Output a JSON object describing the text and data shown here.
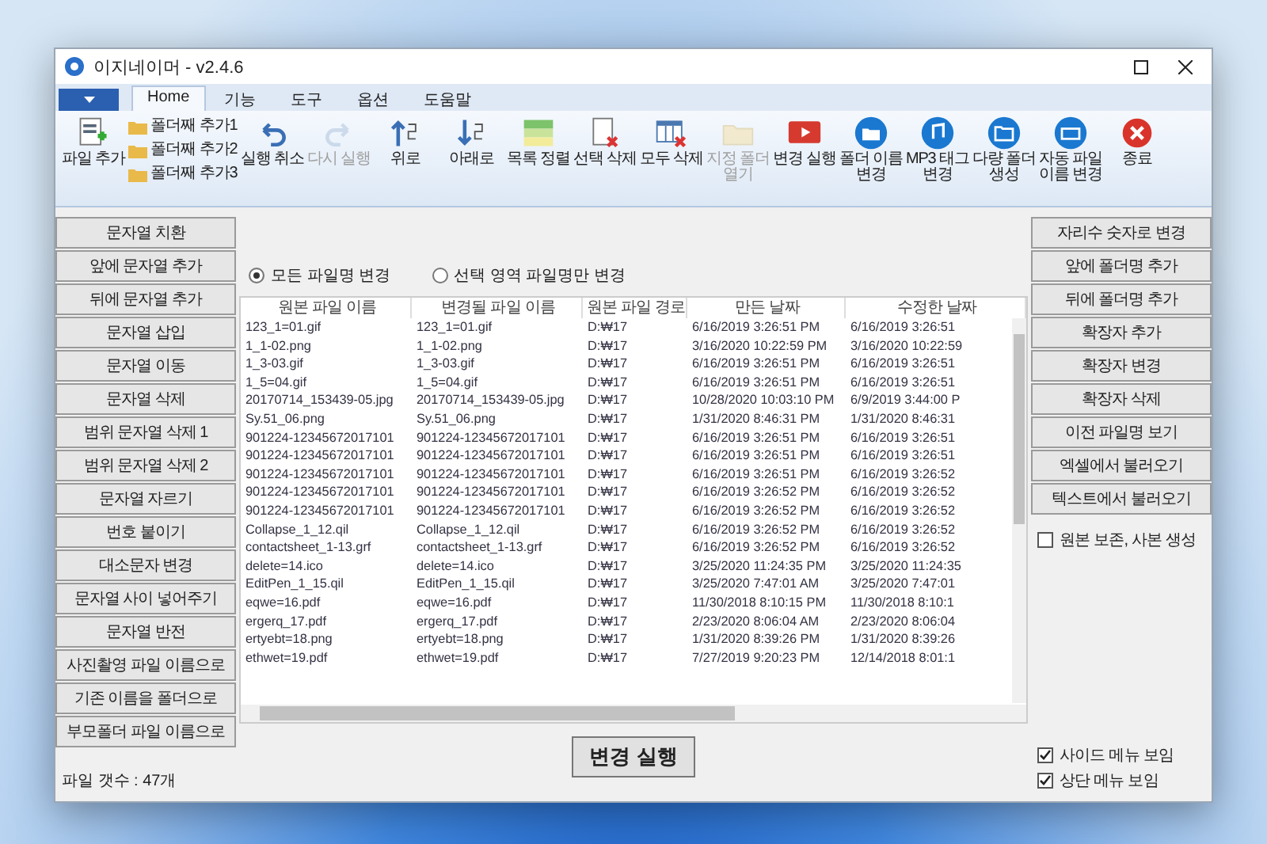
{
  "window": {
    "title": "이지네이머 - v2.4.6"
  },
  "ribbon": {
    "tabs": [
      {
        "label": "Home",
        "selected": true
      },
      {
        "label": "기능",
        "selected": false
      },
      {
        "label": "도구",
        "selected": false
      },
      {
        "label": "옵션",
        "selected": false
      },
      {
        "label": "도움말",
        "selected": false
      }
    ],
    "small_buttons": [
      {
        "label": "폴더째 추가1"
      },
      {
        "label": "폴더째 추가2"
      },
      {
        "label": "폴더째 추가3"
      }
    ],
    "buttons": [
      {
        "label": "파일 추가",
        "disabled": false
      },
      {
        "label": "실행 취소",
        "disabled": false
      },
      {
        "label": "다시 실행",
        "disabled": true
      },
      {
        "label": "위로",
        "disabled": false
      },
      {
        "label": "아래로",
        "disabled": false
      },
      {
        "label": "목록 정렬",
        "disabled": false
      },
      {
        "label": "선택 삭제",
        "disabled": false
      },
      {
        "label": "모두 삭제",
        "disabled": false
      },
      {
        "label": "지정 폴더 열기",
        "disabled": true
      },
      {
        "label": "변경 실행",
        "disabled": false
      },
      {
        "label": "폴더 이름 변경",
        "disabled": false
      },
      {
        "label": "MP3 태그 변경",
        "disabled": false
      },
      {
        "label": "다량 폴더 생성",
        "disabled": false
      },
      {
        "label": "자동 파일 이름 변경",
        "disabled": false
      },
      {
        "label": "종료",
        "disabled": false
      }
    ]
  },
  "left_actions": [
    "문자열 치환",
    "앞에 문자열 추가",
    "뒤에 문자열 추가",
    "문자열 삽입",
    "문자열 이동",
    "문자열 삭제",
    "범위 문자열 삭제 1",
    "범위 문자열 삭제 2",
    "문자열 자르기",
    "번호 붙이기",
    "대소문자 변경",
    "문자열 사이 넣어주기",
    "문자열 반전",
    "사진촬영 파일 이름으로",
    "기존 이름을 폴더으로",
    "부모폴더 파일 이름으로"
  ],
  "mode_options": [
    {
      "label": "모든 파일명 변경",
      "selected": true
    },
    {
      "label": "선택 영역 파일명만 변경",
      "selected": false
    }
  ],
  "file_list": {
    "columns": [
      "원본 파일 이름",
      "변경될 파일 이름",
      "원본 파일 경로",
      "만든 날짜",
      "수정한 날짜"
    ],
    "rows": [
      [
        "123_1=01.gif",
        "123_1=01.gif",
        "D:₩17",
        "6/16/2019 3:26:51 PM",
        "6/16/2019 3:26:51"
      ],
      [
        "1_1-02.png",
        "1_1-02.png",
        "D:₩17",
        "3/16/2020 10:22:59 PM",
        "3/16/2020 10:22:59"
      ],
      [
        "1_3-03.gif",
        "1_3-03.gif",
        "D:₩17",
        "6/16/2019 3:26:51 PM",
        "6/16/2019 3:26:51"
      ],
      [
        "1_5=04.gif",
        "1_5=04.gif",
        "D:₩17",
        "6/16/2019 3:26:51 PM",
        "6/16/2019 3:26:51"
      ],
      [
        "20170714_153439-05.jpg",
        "20170714_153439-05.jpg",
        "D:₩17",
        "10/28/2020 10:03:10 PM",
        "6/9/2019 3:44:00 P"
      ],
      [
        "Sy.51_06.png",
        "Sy.51_06.png",
        "D:₩17",
        "1/31/2020 8:46:31 PM",
        "1/31/2020 8:46:31"
      ],
      [
        "901224-12345672017101",
        "901224-12345672017101",
        "D:₩17",
        "6/16/2019 3:26:51 PM",
        "6/16/2019 3:26:51"
      ],
      [
        "901224-12345672017101",
        "901224-12345672017101",
        "D:₩17",
        "6/16/2019 3:26:51 PM",
        "6/16/2019 3:26:51"
      ],
      [
        "901224-12345672017101",
        "901224-12345672017101",
        "D:₩17",
        "6/16/2019 3:26:51 PM",
        "6/16/2019 3:26:52"
      ],
      [
        "901224-12345672017101",
        "901224-12345672017101",
        "D:₩17",
        "6/16/2019 3:26:52 PM",
        "6/16/2019 3:26:52"
      ],
      [
        "901224-12345672017101",
        "901224-12345672017101",
        "D:₩17",
        "6/16/2019 3:26:52 PM",
        "6/16/2019 3:26:52"
      ],
      [
        "Collapse_1_12.qil",
        "Collapse_1_12.qil",
        "D:₩17",
        "6/16/2019 3:26:52 PM",
        "6/16/2019 3:26:52"
      ],
      [
        "contactsheet_1-13.grf",
        "contactsheet_1-13.grf",
        "D:₩17",
        "6/16/2019 3:26:52 PM",
        "6/16/2019 3:26:52"
      ],
      [
        "delete=14.ico",
        "delete=14.ico",
        "D:₩17",
        "3/25/2020 11:24:35 PM",
        "3/25/2020 11:24:35"
      ],
      [
        "EditPen_1_15.qil",
        "EditPen_1_15.qil",
        "D:₩17",
        "3/25/2020 7:47:01 AM",
        "3/25/2020 7:47:01"
      ],
      [
        "eqwe=16.pdf",
        "eqwe=16.pdf",
        "D:₩17",
        "11/30/2018 8:10:15 PM",
        "11/30/2018 8:10:1"
      ],
      [
        "ergerq_17.pdf",
        "ergerq_17.pdf",
        "D:₩17",
        "2/23/2020 8:06:04 AM",
        "2/23/2020 8:06:04"
      ],
      [
        "ertyebt=18.png",
        "ertyebt=18.png",
        "D:₩17",
        "1/31/2020 8:39:26 PM",
        "1/31/2020 8:39:26"
      ],
      [
        "ethwet=19.pdf",
        "ethwet=19.pdf",
        "D:₩17",
        "7/27/2019 9:20:23 PM",
        "12/14/2018 8:01:1"
      ]
    ]
  },
  "right_actions": [
    "자리수 숫자로 변경",
    "앞에 폴더명 추가",
    "뒤에 폴더명 추가",
    "확장자 추가",
    "확장자 변경",
    "확장자 삭제",
    "이전 파일명 보기",
    "엑셀에서 불러오기",
    "텍스트에서 불러오기"
  ],
  "keep_original": {
    "label": "원본 보존, 사본 생성",
    "checked": false
  },
  "file_count": "파일 갯수 : 47개",
  "run_button": "변경 실행",
  "view_options": [
    {
      "label": "사이드 메뉴 보임",
      "checked": true
    },
    {
      "label": "상단 메뉴 보임",
      "checked": true
    }
  ]
}
